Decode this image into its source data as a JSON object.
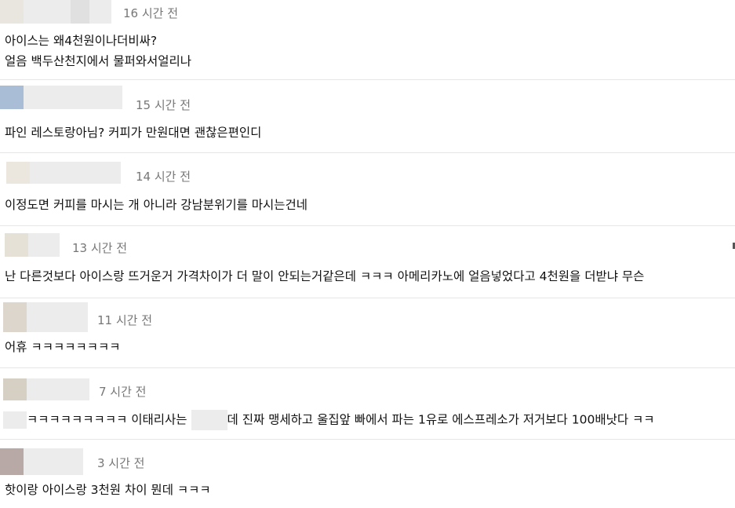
{
  "comments": [
    {
      "time": "16 시간 전",
      "lines": [
        "아이스는 왜4천원이나더비싸?",
        "얼음 백두산천지에서 물퍼와서얼리나"
      ]
    },
    {
      "time": "15 시간 전",
      "lines": [
        "파인 레스토랑아님? 커피가 만원대면 괜찮은편인디"
      ]
    },
    {
      "time": "14 시간 전",
      "lines": [
        "이정도면 커피를 마시는 개 아니라 강남분위기를 마시는건네"
      ]
    },
    {
      "time": "13 시간 전",
      "lines": [
        "난 다른것보다 아이스랑 뜨거운거 가격차이가 더 말이 안되는거같은데 ㅋㅋㅋ 아메리카노에 얼음넣었다고 4천원을 더받냐 무슨"
      ]
    },
    {
      "time": "11 시간 전",
      "lines": [
        "어휴 ㅋㅋㅋㅋㅋㅋㅋㅋ"
      ]
    },
    {
      "time": "7 시간 전",
      "text_a": "ㅋㅋㅋㅋㅋㅋㅋㅋㅋ 이태리사는",
      "text_b": "데 진짜 맹세하고 울집앞 빠에서 파는 1유로 에스프레소가 저거보다 100배낫다 ㅋㅋ"
    },
    {
      "time": "3 시간 전",
      "lines": [
        "핫이랑 아이스랑 3천원 차이 뭔데 ㅋㅋㅋ"
      ]
    }
  ],
  "colors": {
    "timestamp": "#777777",
    "divider": "#e6e6e6",
    "blur": "#ececec"
  }
}
